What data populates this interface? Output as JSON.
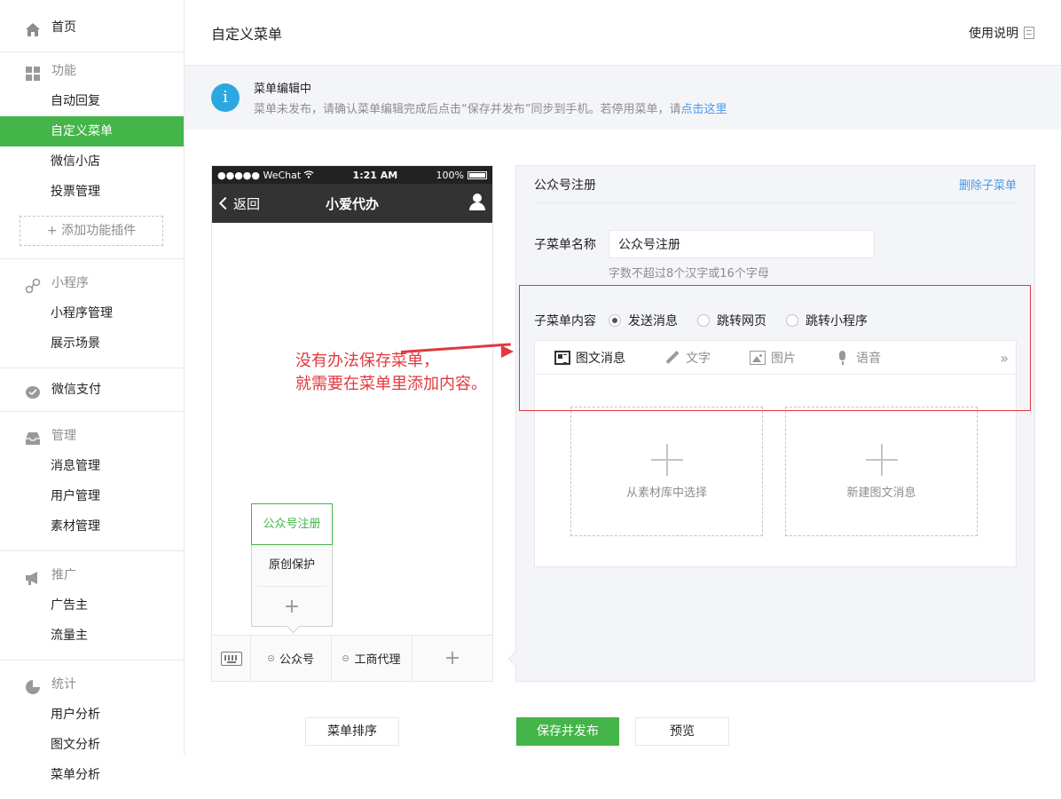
{
  "sidebar": {
    "home": {
      "label": "首页",
      "icon": "home-icon"
    },
    "sections": [
      {
        "head": "功能",
        "icon": "grid-icon",
        "items": [
          "自动回复",
          "自定义菜单",
          "微信小店",
          "投票管理"
        ],
        "active": "自定义菜单",
        "add_plugin": "+ 添加功能插件"
      },
      {
        "head": "小程序",
        "icon": "link-icon",
        "items": [
          "小程序管理",
          "展示场景"
        ]
      },
      {
        "head": "微信支付",
        "icon": "pay-icon",
        "items": []
      },
      {
        "head": "管理",
        "icon": "inbox-icon",
        "items": [
          "消息管理",
          "用户管理",
          "素材管理"
        ]
      },
      {
        "head": "推广",
        "icon": "megaphone-icon",
        "items": [
          "广告主",
          "流量主"
        ]
      },
      {
        "head": "统计",
        "icon": "pie-icon",
        "items": [
          "用户分析",
          "图文分析",
          "菜单分析"
        ]
      }
    ]
  },
  "header": {
    "title": "自定义菜单",
    "help": "使用说明"
  },
  "notice": {
    "title": "菜单编辑中",
    "desc_prefix": "菜单未发布，请确认菜单编辑完成后点击“保存并发布”同步到手机。若停用菜单，请",
    "desc_link": "点击这里"
  },
  "phone": {
    "carrier": "●●●●● WeChat",
    "time": "1:21 AM",
    "battery": "100%",
    "back": "返回",
    "title": "小爱代办",
    "submenu": [
      "公众号注册",
      "原创保护"
    ],
    "bottom_menus": [
      "公众号",
      "工商代理"
    ]
  },
  "editor": {
    "title": "公众号注册",
    "delete": "删除子菜单",
    "name_label": "子菜单名称",
    "name_value": "公众号注册",
    "name_hint": "字数不超过8个汉字或16个字母",
    "content_label": "子菜单内容",
    "radios": [
      {
        "label": "发送消息",
        "checked": true
      },
      {
        "label": "跳转网页",
        "checked": false
      },
      {
        "label": "跳转小程序",
        "checked": false
      }
    ],
    "tabs": [
      "图文消息",
      "文字",
      "图片",
      "语音"
    ],
    "more": "»",
    "cards": [
      "从素材库中选择",
      "新建图文消息"
    ]
  },
  "annotation": {
    "line1": "没有办法保存菜单，",
    "line2": "就需要在菜单里添加内容。",
    "color": "#e2383e"
  },
  "buttons": {
    "sort": "菜单排序",
    "save": "保存并发布",
    "preview": "预览"
  },
  "colors": {
    "accent": "#44b549",
    "link": "#459ae9",
    "info": "#2ea7e0"
  }
}
